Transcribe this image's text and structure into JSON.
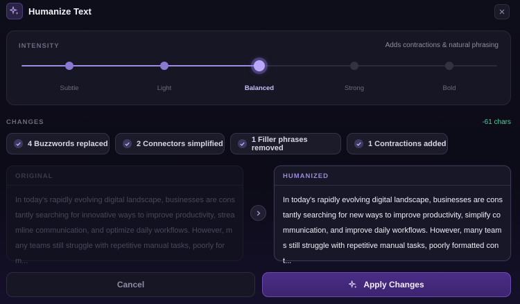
{
  "header": {
    "title": "Humanize Text",
    "icon": "sparkles-icon",
    "close_icon": "close-icon"
  },
  "intensity": {
    "label": "INTENSITY",
    "hint": "Adds contractions & natural phrasing",
    "selected_index": 2,
    "levels": [
      "Subtle",
      "Light",
      "Balanced",
      "Strong",
      "Bold"
    ]
  },
  "changes": {
    "label": "CHANGES",
    "char_delta": "-61 chars",
    "chips": [
      "4 Buzzwords replaced",
      "2 Connectors simplified",
      "1 Filler phrases removed",
      "1 Contractions added"
    ]
  },
  "original": {
    "label": "ORIGINAL",
    "text": "In today's rapidly evolving digital landscape, businesses are constantly searching for innovative ways to improve productivity, streamline communication, and optimize daily workflows. However, many teams still struggle with repetitive manual tasks, poorly form..."
  },
  "humanized": {
    "label": "HUMANIZED",
    "text": "In today's rapidly evolving digital landscape, businesses are constantly searching for new ways to improve productivity, simplify communication, and improve daily workflows. However, many teams still struggle with repetitive manual tasks, poorly formatted cont..."
  },
  "footer": {
    "cancel_label": "Cancel",
    "apply_label": "Apply Changes"
  },
  "colors": {
    "accent": "#9d8ce0",
    "positive": "#42d39a",
    "apply_bg": "#4a2d86"
  }
}
